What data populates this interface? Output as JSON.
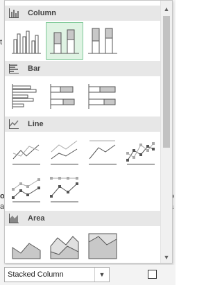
{
  "gallery": {
    "categories": [
      {
        "label": "Column",
        "icon": "column-chart-icon"
      },
      {
        "label": "Bar",
        "icon": "bar-chart-icon"
      },
      {
        "label": "Line",
        "icon": "line-chart-icon"
      },
      {
        "label": "Area",
        "icon": "area-chart-icon"
      }
    ],
    "selected_tile": "stacked-column"
  },
  "footer": {
    "chart_type_value": "Stacked Column",
    "checkbox_checked": false
  },
  "colors": {
    "selection_bg": "#dff3e3",
    "selection_border": "#7fc998",
    "header_bg": "#e7e7e7",
    "series_gray": "#c8c8c8"
  }
}
